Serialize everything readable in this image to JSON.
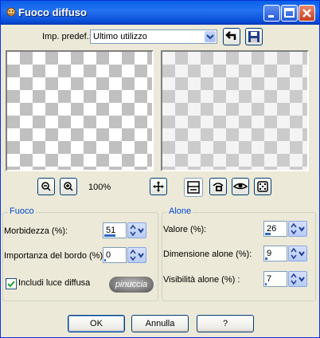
{
  "window": {
    "title": "Fuoco diffuso"
  },
  "preset": {
    "label": "Imp. predef.:",
    "value": "Ultimo utilizzo"
  },
  "zoom": {
    "level": "100%"
  },
  "fuoco": {
    "title": "Fuoco",
    "morbidezza": {
      "label": "Morbidezza (%):",
      "value": "51",
      "fill": 0.51
    },
    "importanza": {
      "label": "Importanza del bordo (%):",
      "value": "0",
      "fill": 0.0
    },
    "includi": {
      "label": "Includi luce diffusa",
      "checked": true
    },
    "badge": "pinuccia"
  },
  "alone": {
    "title": "Alone",
    "valore": {
      "label": "Valore (%):",
      "value": "26",
      "fill": 0.26
    },
    "dimensione": {
      "label": "Dimensione alone (%):",
      "value": "9",
      "fill": 0.09
    },
    "visibilita": {
      "label": "Visibilità alone (%) :",
      "value": "7",
      "fill": 0.07
    }
  },
  "buttons": {
    "ok": "OK",
    "annulla": "Annulla",
    "help": "?"
  }
}
